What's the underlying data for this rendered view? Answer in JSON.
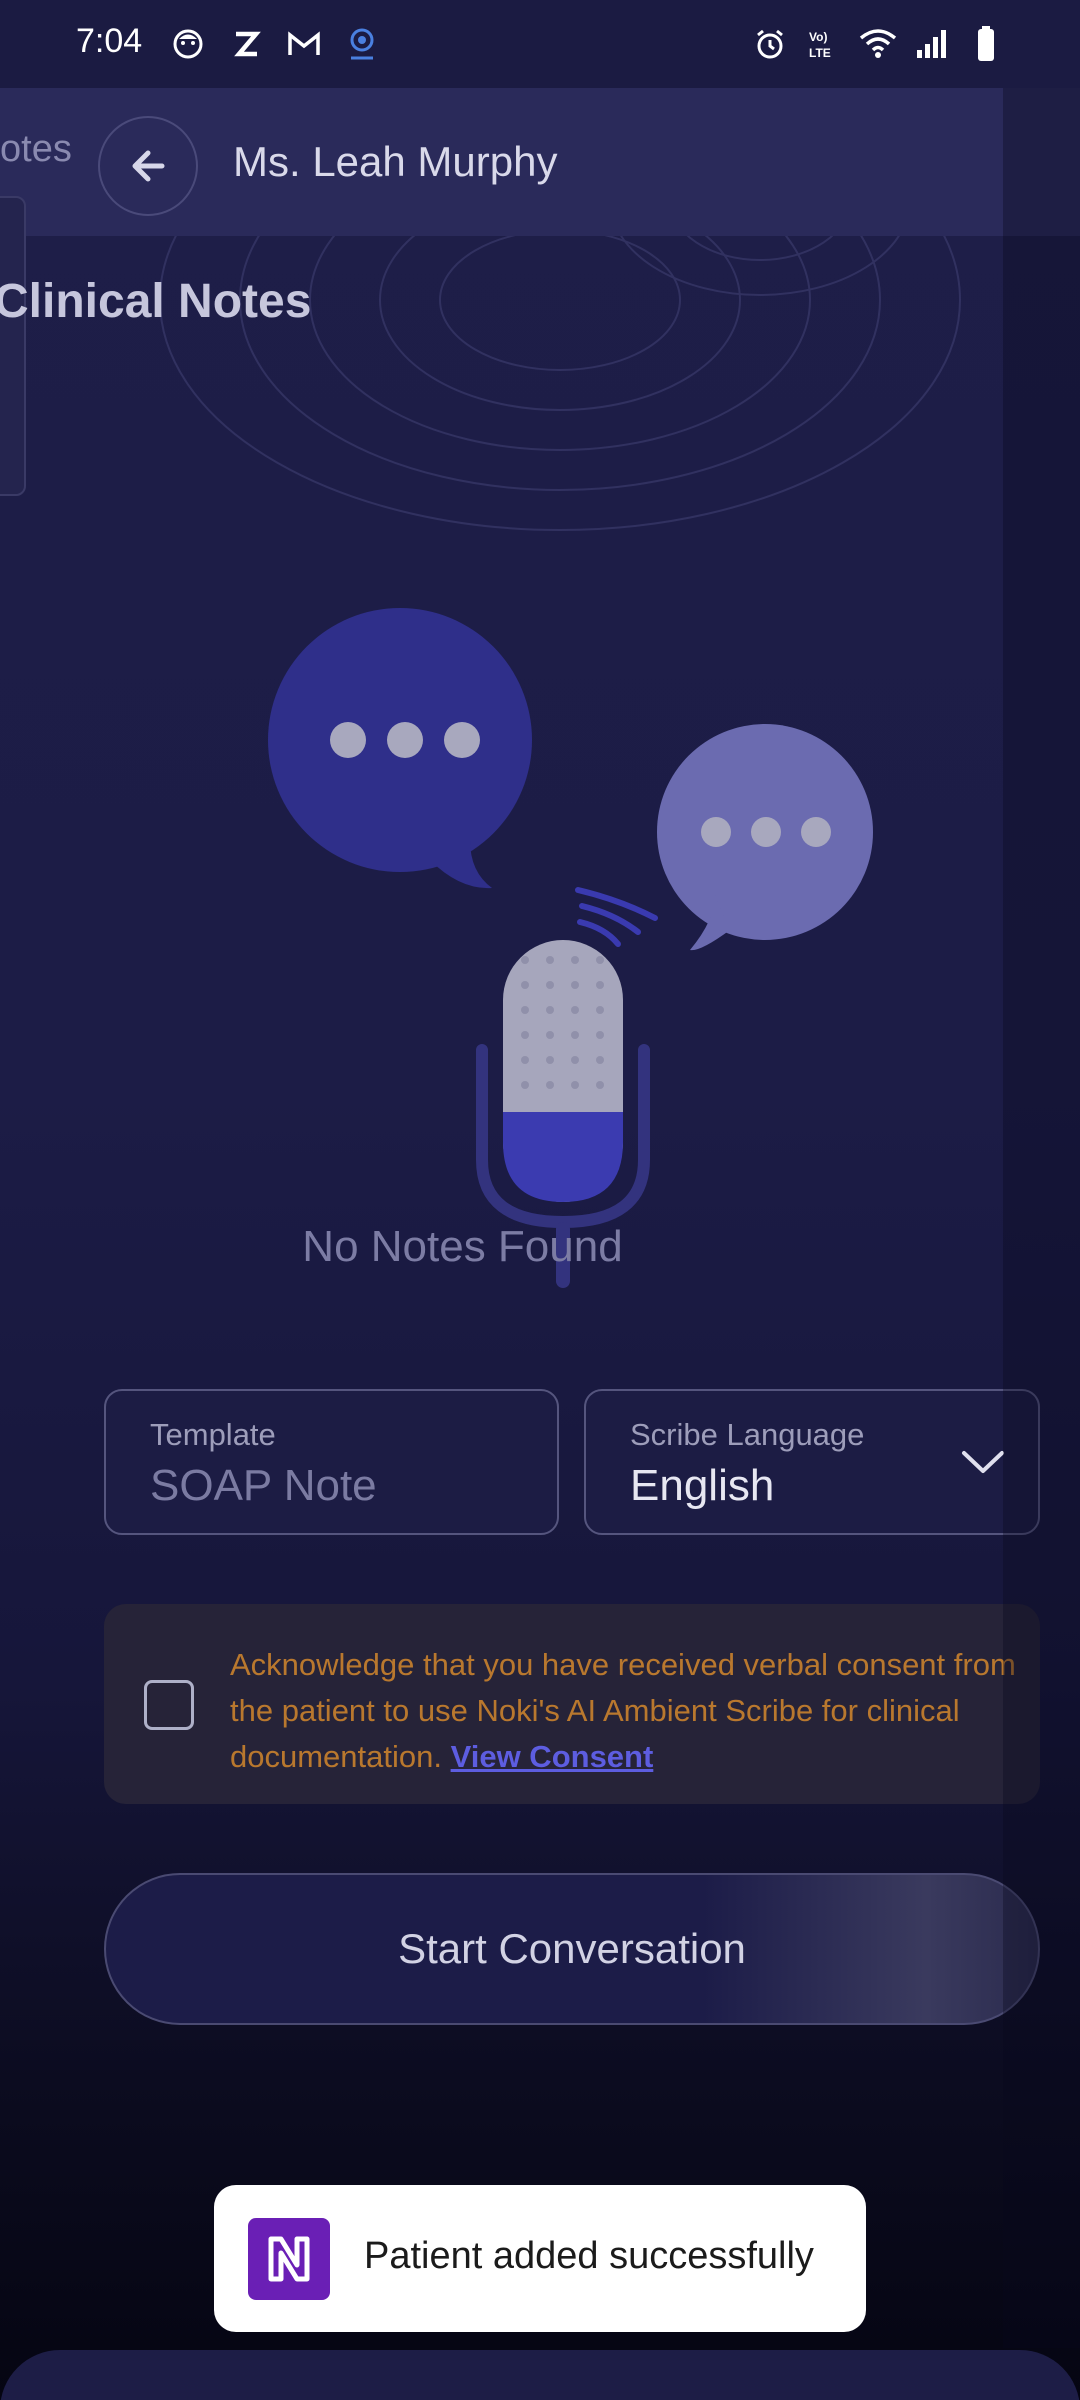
{
  "status_bar": {
    "time": "7:04",
    "left_icons": [
      "baby-face-icon",
      "z-app-icon",
      "gmail-icon",
      "webcam-icon"
    ],
    "right_icons": [
      "alarm-icon",
      "volte-icon",
      "wifi-icon",
      "signal-icon",
      "battery-icon"
    ]
  },
  "header": {
    "ghost_title": "otes",
    "patient_name": "Ms. Leah Murphy"
  },
  "section": {
    "title": "Clinical Notes"
  },
  "empty_state": {
    "message": "No Notes Found"
  },
  "template_field": {
    "label": "Template",
    "value": "SOAP Note"
  },
  "language_field": {
    "label": "Scribe Language",
    "value": "English"
  },
  "consent": {
    "text": "Acknowledge that you have received verbal consent from the patient to use Noki's AI Ambient Scribe for clinical documentation.",
    "link_label": "View Consent",
    "checked": false
  },
  "start_button": {
    "label": "Start Conversation"
  },
  "toast": {
    "message": "Patient added successfully"
  },
  "colors": {
    "background": "#1c1c46",
    "bubble_primary": "#2f2f8a",
    "bubble_secondary": "#6b6bb0",
    "consent_text": "#b9782e",
    "link": "#5d5de0",
    "toast_logo": "#6a1fb5"
  }
}
